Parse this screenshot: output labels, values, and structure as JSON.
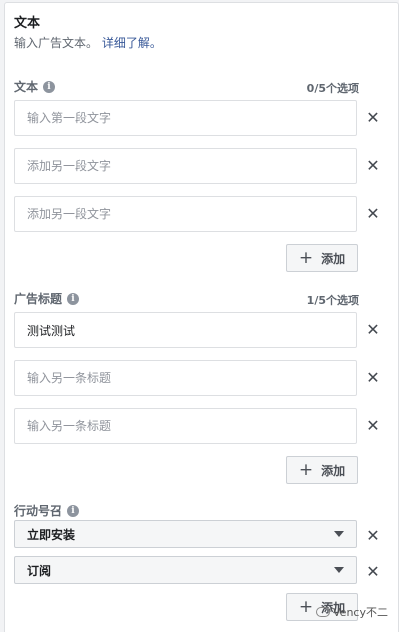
{
  "header": {
    "title": "文本",
    "description": "输入广告文本。",
    "learn_more": "详细了解。"
  },
  "text_section": {
    "label": "文本",
    "count": "0/5个选项",
    "fields": [
      {
        "value": "",
        "placeholder": "输入第一段文字"
      },
      {
        "value": "",
        "placeholder": "添加另一段文字"
      },
      {
        "value": "",
        "placeholder": "添加另一段文字"
      }
    ],
    "add_label": "添加"
  },
  "headline_section": {
    "label": "广告标题",
    "count": "1/5个选项",
    "fields": [
      {
        "value": "测试测试",
        "placeholder": ""
      },
      {
        "value": "",
        "placeholder": "输入另一条标题"
      },
      {
        "value": "",
        "placeholder": "输入另一条标题"
      }
    ],
    "add_label": "添加"
  },
  "cta_section": {
    "label": "行动号召",
    "selects": [
      {
        "value": "立即安装"
      },
      {
        "value": "订阅"
      }
    ],
    "add_label": "添加"
  },
  "icons": {
    "info": "info-icon",
    "close": "close-icon",
    "plus": "plus-icon",
    "dropdown": "caret-down-icon"
  },
  "glyphs": {
    "info": "i",
    "close": "✕",
    "plus": "+"
  },
  "watermark": {
    "text": "Vency不二"
  },
  "colors": {
    "link": "#385898",
    "border": "#dddfe2",
    "muted": "#606770"
  }
}
